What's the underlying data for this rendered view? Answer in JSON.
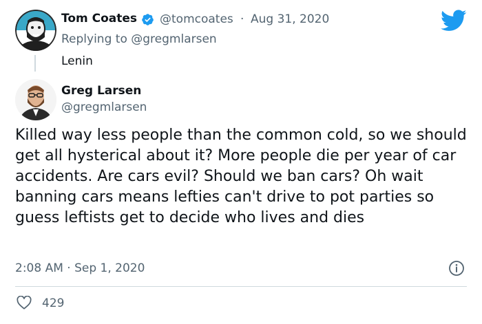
{
  "parent_tweet": {
    "author_name": "Tom Coates",
    "handle": "@tomcoates",
    "separator": "·",
    "date": "Aug 31, 2020",
    "replying_prefix": "Replying to ",
    "replying_to": "@gregmlarsen",
    "text": "Lenin",
    "avatar_icon": "cartoon-bearded-man-avatar"
  },
  "main_tweet": {
    "author_name": "Greg Larsen",
    "handle": "@gregmlarsen",
    "avatar_icon": "photo-bearded-man-avatar",
    "text": "Killed way less people than the common cold, so we should get all hysterical about it? More people die per year of car accidents. Are cars evil? Should we ban cars? Oh wait banning cars means lefties can't drive to pot parties so guess leftists get to decide who lives and dies",
    "timestamp": "2:08 AM · Sep 1, 2020",
    "likes": "429"
  },
  "icons": {
    "brand": "twitter-bird-icon",
    "verified": "verified-badge-icon",
    "info": "info-icon",
    "like": "heart-outline-icon"
  },
  "colors": {
    "brand_blue": "#1d9bf0",
    "text_primary": "#0f1419",
    "text_secondary": "#536471",
    "divider": "#cfd9de"
  }
}
